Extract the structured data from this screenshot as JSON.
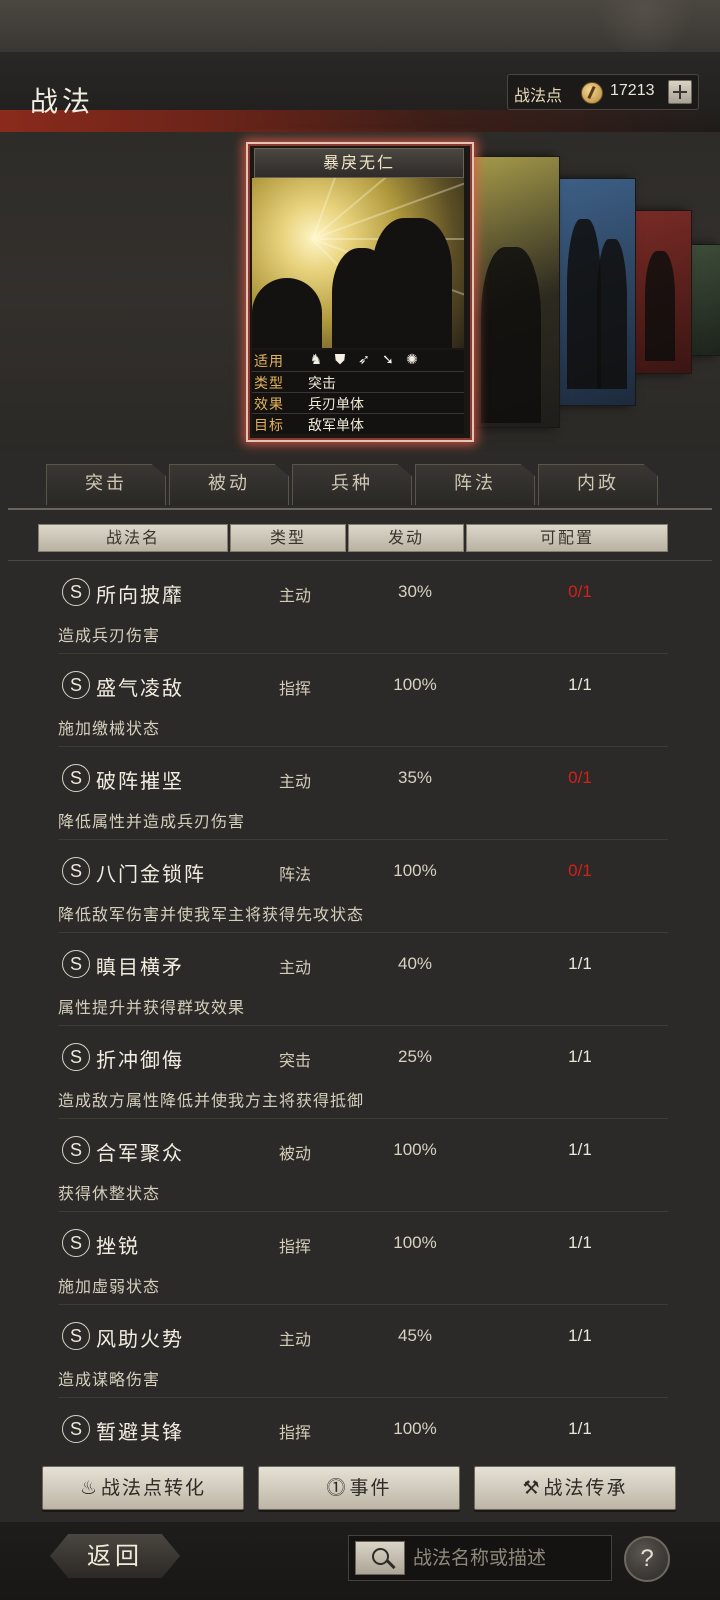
{
  "header": {
    "title": "战法",
    "points_label": "战法点",
    "points_value": "17213"
  },
  "card": {
    "name": "暴戾无仁",
    "stats": [
      {
        "key": "适用",
        "value": ""
      },
      {
        "key": "类型",
        "value": "突击"
      },
      {
        "key": "效果",
        "value": "兵刃单体"
      },
      {
        "key": "目标",
        "value": "敌军单体"
      }
    ],
    "unit_icons": [
      "cavalry-icon",
      "shield-icon",
      "archer-icon",
      "spear-icon",
      "chariot-icon"
    ]
  },
  "tabs": [
    "突击",
    "被动",
    "兵种",
    "阵法",
    "内政"
  ],
  "columns": [
    "战法名",
    "类型",
    "发动",
    "可配置"
  ],
  "skills": [
    {
      "grade": "S",
      "name": "所向披靡",
      "type": "主动",
      "rate": "30%",
      "slot": "0/1",
      "desc": "造成兵刃伤害"
    },
    {
      "grade": "S",
      "name": "盛气凌敌",
      "type": "指挥",
      "rate": "100%",
      "slot": "1/1",
      "desc": "施加缴械状态"
    },
    {
      "grade": "S",
      "name": "破阵摧坚",
      "type": "主动",
      "rate": "35%",
      "slot": "0/1",
      "desc": "降低属性并造成兵刃伤害"
    },
    {
      "grade": "S",
      "name": "八门金锁阵",
      "type": "阵法",
      "rate": "100%",
      "slot": "0/1",
      "desc": "降低敌军伤害并使我军主将获得先攻状态"
    },
    {
      "grade": "S",
      "name": "瞋目横矛",
      "type": "主动",
      "rate": "40%",
      "slot": "1/1",
      "desc": "属性提升并获得群攻效果"
    },
    {
      "grade": "S",
      "name": "折冲御侮",
      "type": "突击",
      "rate": "25%",
      "slot": "1/1",
      "desc": "造成敌方属性降低并使我方主将获得抵御"
    },
    {
      "grade": "S",
      "name": "合军聚众",
      "type": "被动",
      "rate": "100%",
      "slot": "1/1",
      "desc": "获得休整状态"
    },
    {
      "grade": "S",
      "name": "挫锐",
      "type": "指挥",
      "rate": "100%",
      "slot": "1/1",
      "desc": "施加虚弱状态"
    },
    {
      "grade": "S",
      "name": "风助火势",
      "type": "主动",
      "rate": "45%",
      "slot": "1/1",
      "desc": "造成谋略伤害"
    },
    {
      "grade": "S",
      "name": "暂避其锋",
      "type": "指挥",
      "rate": "100%",
      "slot": "1/1",
      "desc": ""
    }
  ],
  "bottom_buttons": {
    "convert": "战法点转化",
    "events": "事件",
    "inherit": "战法传承"
  },
  "footer": {
    "back": "返回",
    "search_placeholder": "战法名称或描述",
    "help": "?"
  },
  "colors": {
    "accent_red": "#d2201a",
    "card_glow": "#e7c3b6",
    "stat_key": "#e3b35a"
  }
}
